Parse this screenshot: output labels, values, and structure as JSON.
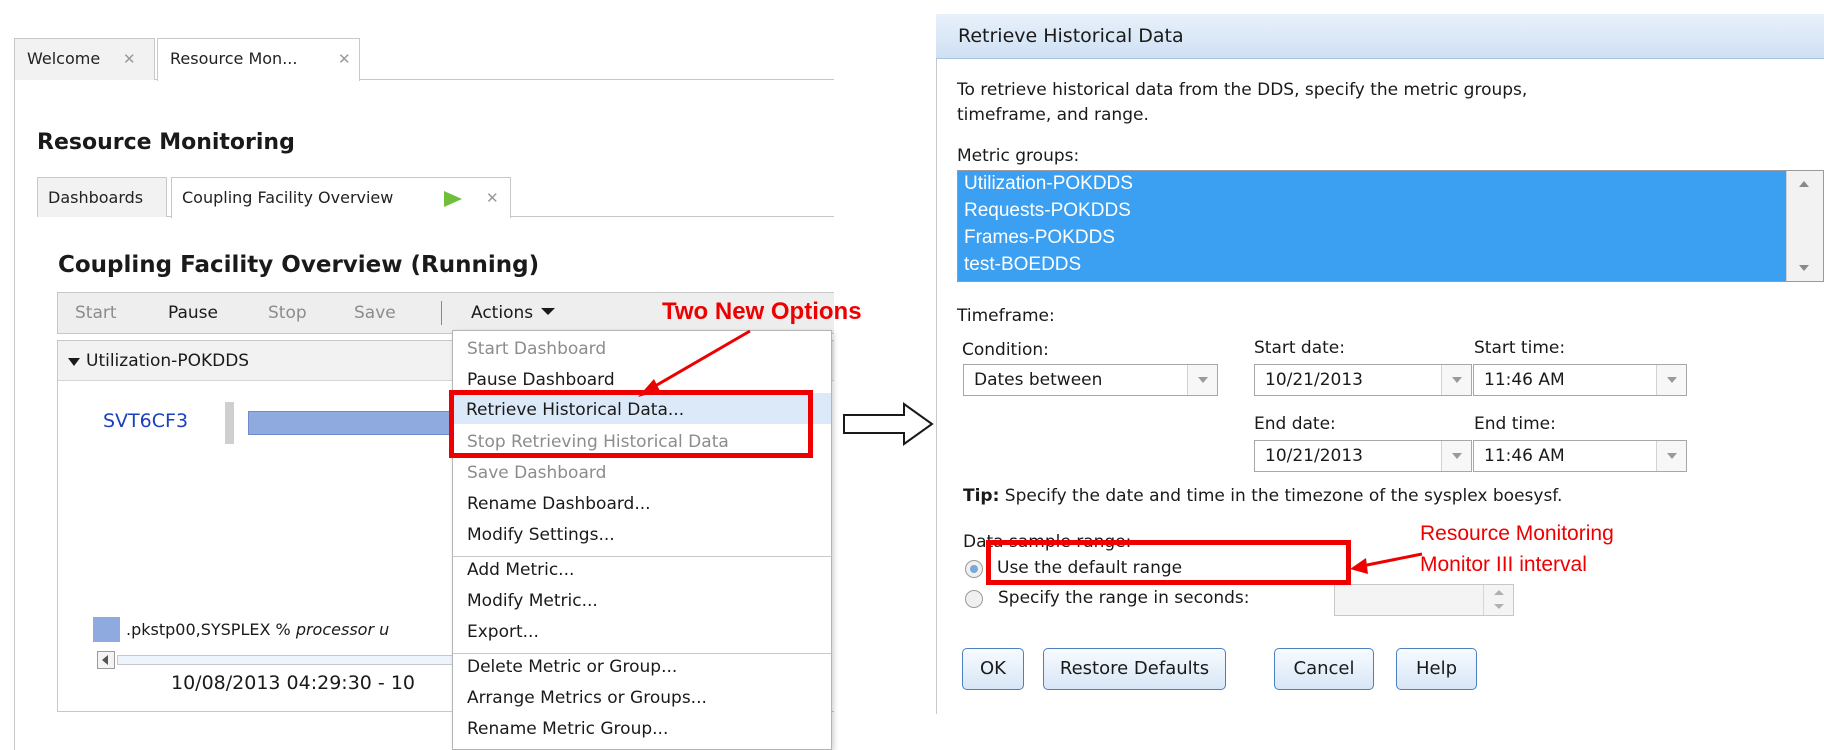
{
  "outer_tabs": [
    {
      "label": "Welcome",
      "close": "✕"
    },
    {
      "label": "Resource Mon...",
      "close": "✕"
    }
  ],
  "page_title": "Resource Monitoring",
  "inner_tabs": [
    {
      "label": "Dashboards"
    },
    {
      "label": "Coupling Facility Overview",
      "close": "✕"
    }
  ],
  "dashboard_title": "Coupling Facility Overview (Running)",
  "toolbar": {
    "start": "Start",
    "pause": "Pause",
    "stop": "Stop",
    "save": "Save",
    "actions": "Actions"
  },
  "panel": {
    "group_label": "Utilization-POKDDS",
    "bar_label": "SVT6CF3",
    "legend_text": ".pkstp00,SYSPLEX % ",
    "legend_italic": "processor u",
    "date_range": "10/08/2013 04:29:30 - 10"
  },
  "menu": {
    "items": [
      {
        "label": "Start Dashboard",
        "enabled": false
      },
      {
        "label": "Pause Dashboard",
        "enabled": true
      },
      {
        "label": "Retrieve Historical Data...",
        "enabled": true,
        "highlighted": true
      },
      {
        "label": "Stop Retrieving Historical Data",
        "enabled": false
      },
      {
        "label": "Save Dashboard",
        "enabled": false
      },
      {
        "label": "Rename Dashboard...",
        "enabled": true
      },
      {
        "label": "Modify Settings...",
        "enabled": true
      },
      {
        "label": "Add Metric...",
        "enabled": true
      },
      {
        "label": "Modify Metric...",
        "enabled": true
      },
      {
        "label": "Export...",
        "enabled": true
      },
      {
        "label": "Delete Metric or Group...",
        "enabled": true
      },
      {
        "label": "Arrange Metrics or Groups...",
        "enabled": true
      },
      {
        "label": "Rename Metric Group...",
        "enabled": true
      }
    ]
  },
  "annotations": {
    "two_new_options": "Two New Options",
    "rm_note_line1": "Resource Monitoring",
    "rm_note_line2": "Monitor III interval"
  },
  "colors": {
    "annotation_red": "#ee0000",
    "selection_blue": "#3b9ff2",
    "bar_blue": "#8eaade",
    "play_green": "#6fbf3a",
    "link_blue": "#1a3fbf"
  },
  "dialog": {
    "title": "Retrieve Historical Data",
    "intro_line1": "To retrieve historical data from the DDS, specify the metric groups,",
    "intro_line2": "timeframe, and range.",
    "metric_groups_label": "Metric groups:",
    "metric_groups": [
      "Utilization-POKDDS",
      "Requests-POKDDS",
      "Frames-POKDDS",
      "test-BOEDDS"
    ],
    "timeframe_label": "Timeframe:",
    "condition_label": "Condition:",
    "condition_value": "Dates between",
    "start_date_label": "Start date:",
    "start_date": "10/21/2013",
    "start_time_label": "Start time:",
    "start_time": "11:46 AM",
    "end_date_label": "End date:",
    "end_date": "10/21/2013",
    "end_time_label": "End time:",
    "end_time": "11:46 AM",
    "tip_bold": "Tip:",
    "tip_text": " Specify the date and time in the timezone of the sysplex boesysf.",
    "range_label": "Data sample range:",
    "radio_default": "Use the default range",
    "radio_specify": "Specify the range in seconds:",
    "buttons": {
      "ok": "OK",
      "restore": "Restore Defaults",
      "cancel": "Cancel",
      "help": "Help"
    }
  }
}
